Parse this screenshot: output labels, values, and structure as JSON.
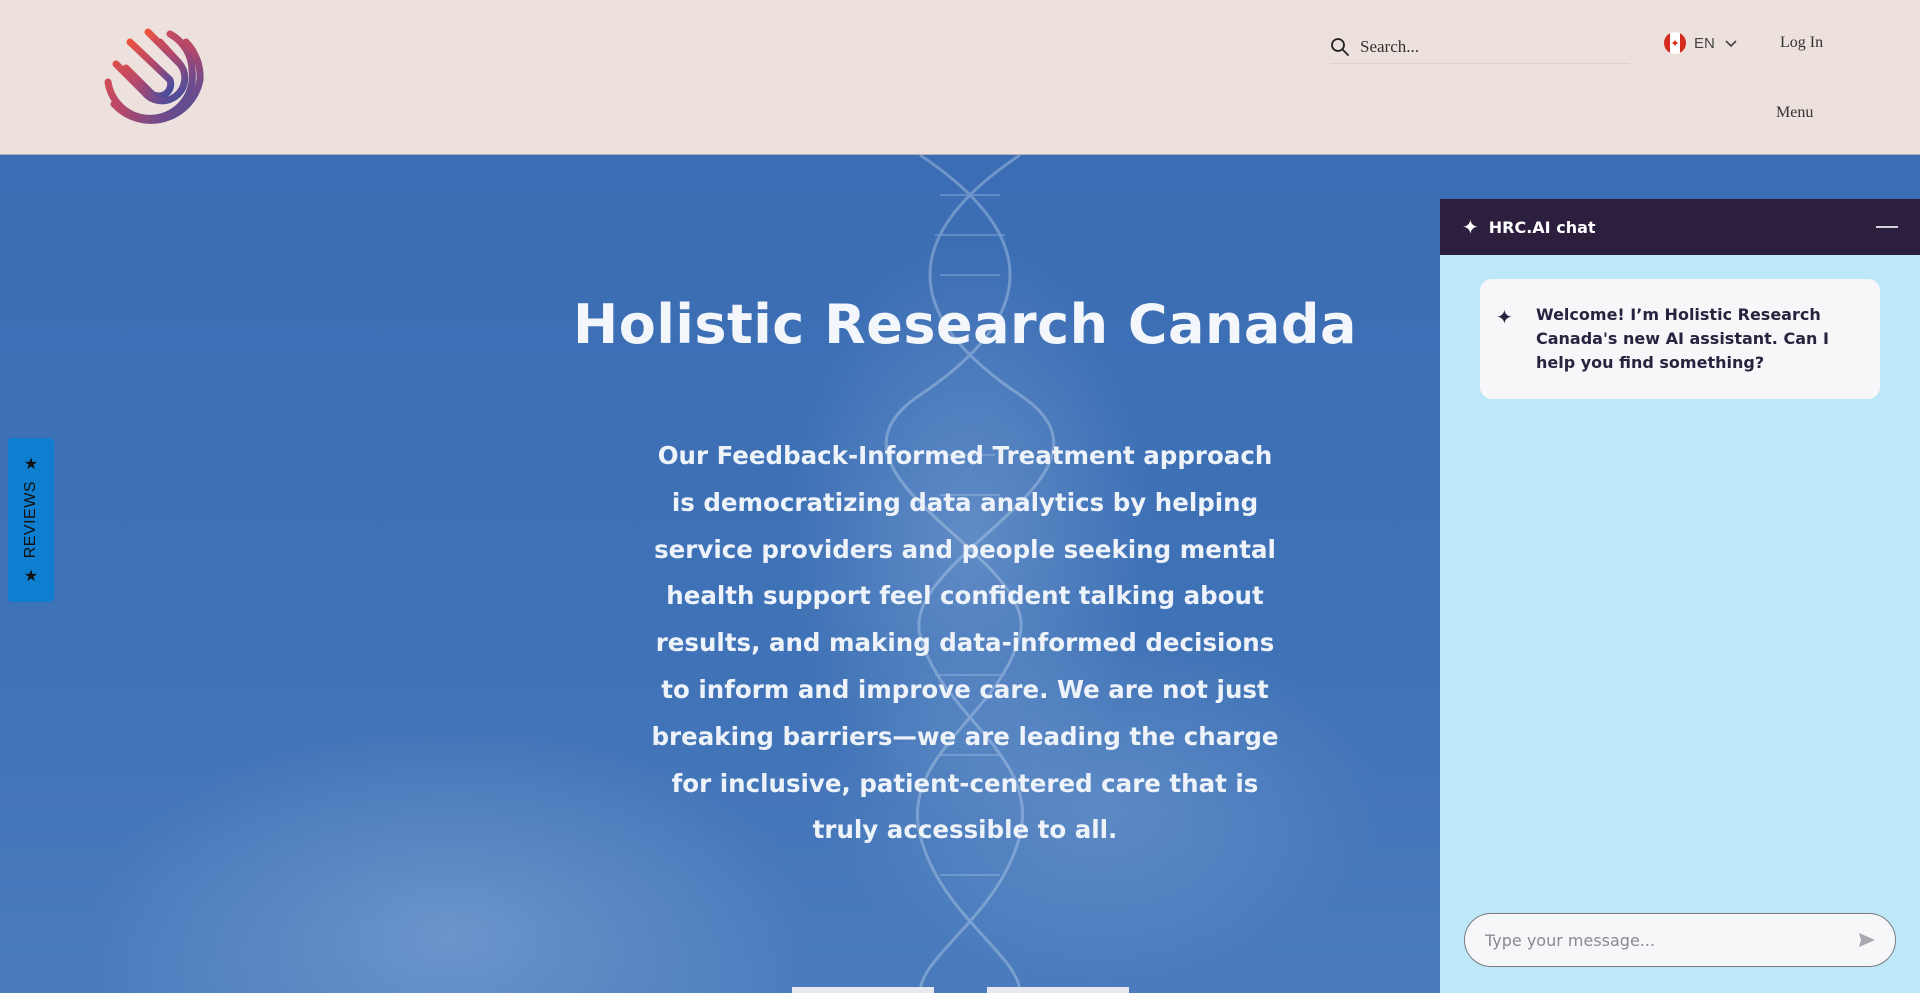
{
  "header": {
    "search_placeholder": "Search...",
    "language": "EN",
    "login_label": "Log In",
    "menu_label": "Menu",
    "logo_colors": [
      "#e9543f",
      "#b8496a",
      "#3a4fa3"
    ]
  },
  "hero": {
    "title": "Holistic Research Canada",
    "body": "Our Feedback-Informed Treatment approach is democratizing data analytics by helping service providers and people seeking mental health support feel confident talking about results, and making data-informed decisions to inform and improve care. We are not just breaking barriers—we are leading the charge for inclusive, patient-centered care that is truly accessible to all."
  },
  "reviews_tab": {
    "label": "REVIEWS"
  },
  "chat": {
    "title": "HRC.AI chat",
    "welcome_message": "Welcome! I’m Holistic Research Canada's new AI assistant. Can I help you find something?",
    "input_placeholder": "Type your message..."
  },
  "colors": {
    "header_bg": "#ece1dc",
    "hero_bg": "#3b6db4",
    "chat_bg": "#bee7f7",
    "chat_header_bg": "#2b1f3d",
    "reviews_bg": "#0e7fd0"
  }
}
